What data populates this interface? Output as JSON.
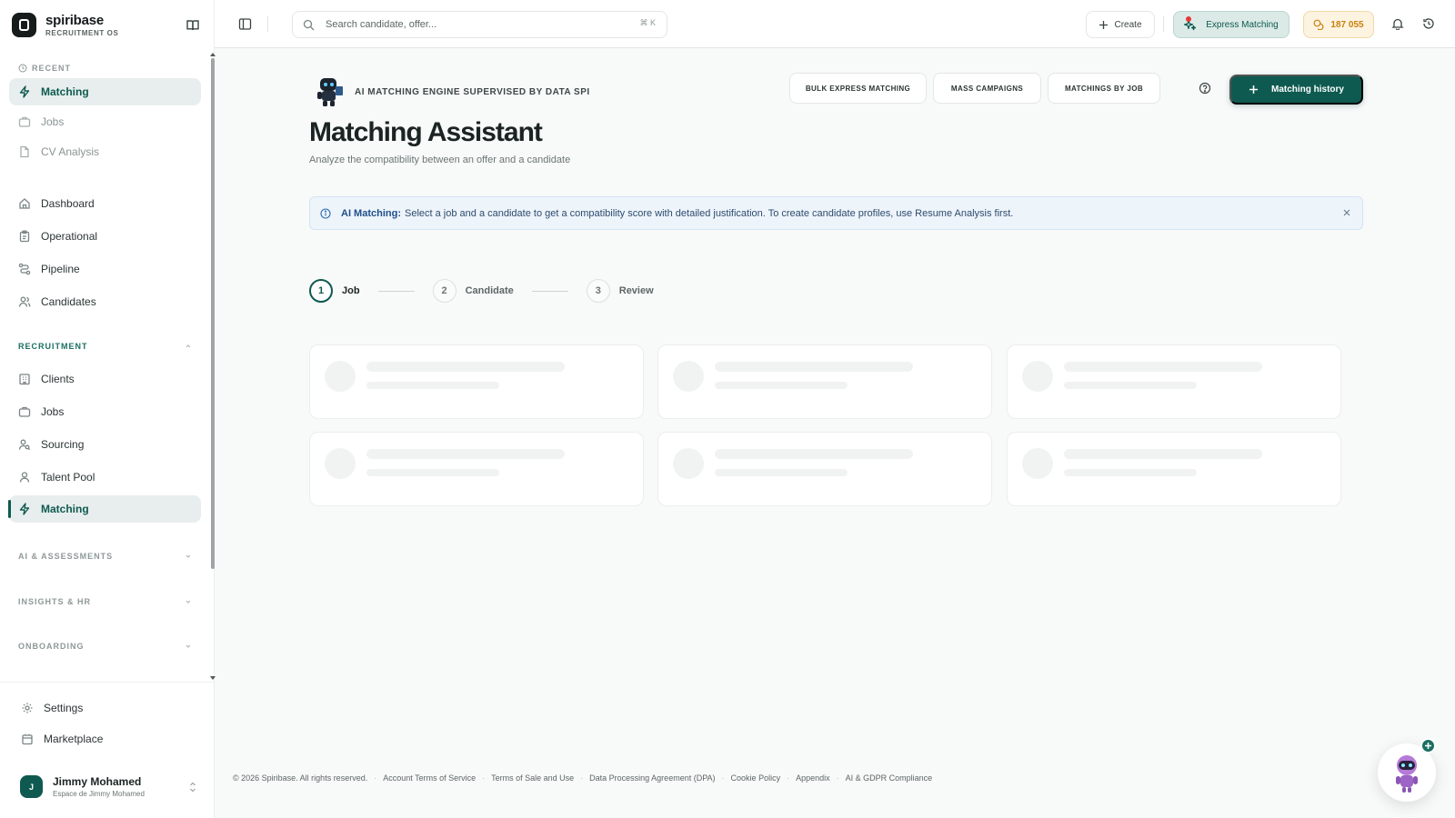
{
  "brand": {
    "name": "spiribase",
    "subtitle": "RECRUITMENT OS"
  },
  "sidebar": {
    "recent_label": "RECENT",
    "recent": [
      {
        "label": "Matching",
        "icon": "bolt-icon",
        "active": true
      },
      {
        "label": "Jobs",
        "icon": "briefcase-icon"
      },
      {
        "label": "CV Analysis",
        "icon": "file-icon"
      }
    ],
    "main": [
      {
        "label": "Dashboard",
        "icon": "home-icon"
      },
      {
        "label": "Operational",
        "icon": "clipboard-icon"
      },
      {
        "label": "Pipeline",
        "icon": "route-icon"
      },
      {
        "label": "Candidates",
        "icon": "users-icon"
      }
    ],
    "recruitment_label": "RECRUITMENT",
    "recruitment": [
      {
        "label": "Clients",
        "icon": "building-icon"
      },
      {
        "label": "Jobs",
        "icon": "briefcase-icon"
      },
      {
        "label": "Sourcing",
        "icon": "user-search-icon"
      },
      {
        "label": "Talent Pool",
        "icon": "user-icon"
      },
      {
        "label": "Matching",
        "icon": "bolt-icon",
        "active": true
      }
    ],
    "sections": [
      "AI & ASSESSMENTS",
      "INSIGHTS & HR",
      "ONBOARDING"
    ],
    "bottom": [
      {
        "label": "Settings",
        "icon": "gear-icon"
      },
      {
        "label": "Marketplace",
        "icon": "store-icon"
      }
    ],
    "user": {
      "initial": "J",
      "name": "Jimmy Mohamed",
      "workspace": "Espace de Jimmy Mohamed"
    }
  },
  "topbar": {
    "search_placeholder": "Search candidate, offer...",
    "shortcut": "⌘ K",
    "create_label": "Create",
    "express_label": "Express Matching",
    "credits": "187 055"
  },
  "page": {
    "engine_label": "AI MATCHING ENGINE SUPERVISED BY DATA SPI",
    "title": "Matching Assistant",
    "subtitle": "Analyze the compatibility between an offer and a candidate",
    "header_buttons": [
      "BULK EXPRESS MATCHING",
      "MASS CAMPAIGNS",
      "MATCHINGS BY JOB"
    ],
    "history_label": "Matching history",
    "alert": {
      "title": "AI Matching:",
      "text": "Select a job and a candidate to get a compatibility score with detailed justification. To create candidate profiles, use Resume Analysis first."
    },
    "steps": [
      {
        "num": "1",
        "label": "Job",
        "active": true
      },
      {
        "num": "2",
        "label": "Candidate",
        "active": false
      },
      {
        "num": "3",
        "label": "Review",
        "active": false
      }
    ]
  },
  "footer": {
    "copyright": "© 2026 Spiribase. All rights reserved.",
    "links": [
      "Account Terms of Service",
      "Terms of Sale and Use",
      "Data Processing Agreement (DPA)",
      "Cookie Policy",
      "Appendix",
      "AI & GDPR Compliance"
    ]
  },
  "colors": {
    "accent": "#0e5a50",
    "credits": "#c8820c",
    "alert_bg": "#edf4fa"
  }
}
